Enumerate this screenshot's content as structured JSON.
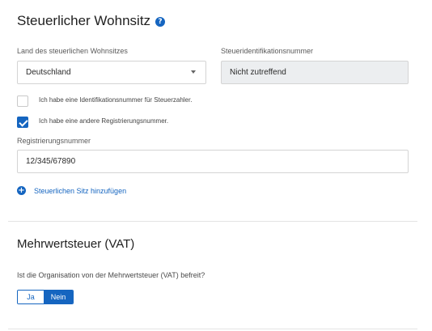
{
  "tax_residence": {
    "title": "Steuerlicher Wohnsitz",
    "help_icon": "?",
    "country_label": "Land des steuerlichen Wohnsitzes",
    "country_value": "Deutschland",
    "tin_label": "Steueridentifikationsnummer",
    "tin_value": "Nicht zutreffend",
    "checkbox_tin": {
      "label": "Ich habe eine Identifikationsnummer für Steuerzahler.",
      "checked": false
    },
    "checkbox_other": {
      "label": "Ich habe eine andere Registrierungsnummer.",
      "checked": true
    },
    "reg_label": "Registrierungsnummer",
    "reg_value": "12/345/67890",
    "add_link": "Steuerlichen Sitz hinzufügen"
  },
  "vat": {
    "title": "Mehrwertsteuer (VAT)",
    "question": "Ist die Organisation von der Mehrwertsteuer (VAT) befreit?",
    "options": [
      "Ja",
      "Nein"
    ],
    "selected": "Nein"
  },
  "colors": {
    "accent": "#1565c0",
    "disabled_bg": "#eceef0",
    "border": "#d4d4d4"
  }
}
